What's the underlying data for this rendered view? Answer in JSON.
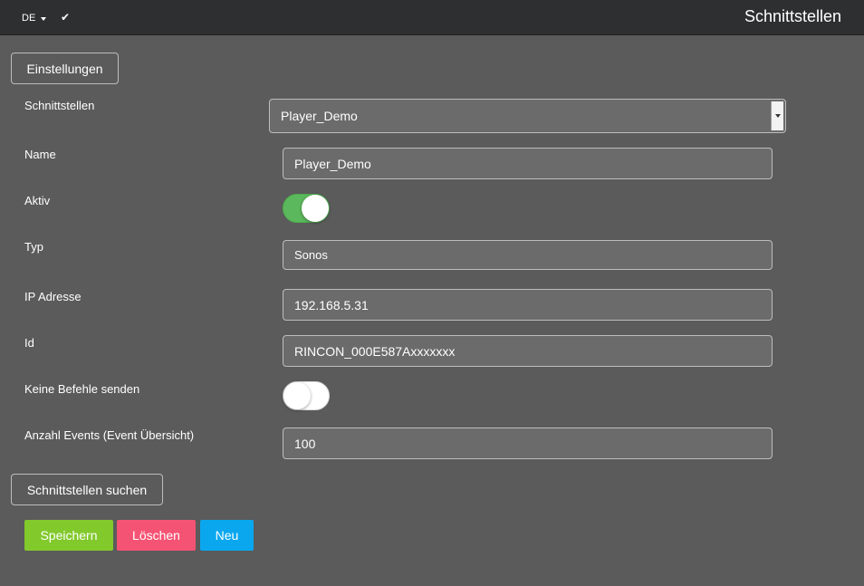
{
  "header": {
    "language": "DE",
    "title": "Schnittstellen"
  },
  "buttons": {
    "settings": "Einstellungen",
    "search": "Schnittstellen suchen",
    "save": "Speichern",
    "delete": "Löschen",
    "new": "Neu"
  },
  "form": {
    "interface_label": "Schnittstellen",
    "interface_selected": "Player_Demo",
    "name_label": "Name",
    "name_value": "Player_Demo",
    "active_label": "Aktiv",
    "active_value": true,
    "type_label": "Typ",
    "type_value": "Sonos",
    "ip_label": "IP Adresse",
    "ip_value": "192.168.5.31",
    "id_label": "Id",
    "id_value": "RINCON_000E587Axxxxxxx",
    "no_commands_label": "Keine Befehle senden",
    "no_commands_value": false,
    "events_label": "Anzahl Events (Event Übersicht)",
    "events_value": "100"
  },
  "colors": {
    "background": "#5b5b5b",
    "topbar": "#2e2f31",
    "save": "#82c92c",
    "delete": "#f55374",
    "new": "#0aa7ef",
    "toggle_on": "#5cb85c"
  },
  "icons": {
    "check": "check-icon",
    "caret": "caret-down-icon"
  }
}
